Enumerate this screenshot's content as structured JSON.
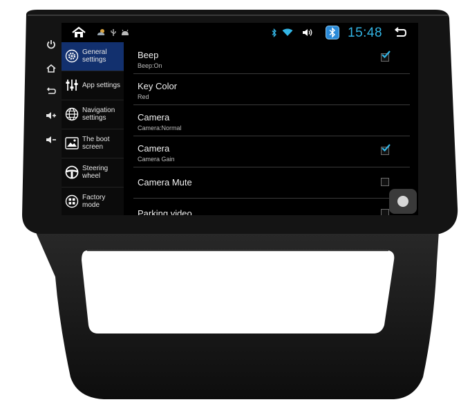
{
  "status_bar": {
    "clock": "15:48",
    "icons": [
      "home-icon",
      "weather-icon",
      "usb-icon",
      "android-icon",
      "bluetooth-icon",
      "wifi-icon",
      "volume-icon",
      "bluetooth-app-icon",
      "back-icon"
    ],
    "accent_color": "#33b5e5"
  },
  "bezel_buttons": [
    "power-icon",
    "home-icon",
    "back-icon",
    "volume-up-icon",
    "volume-down-icon"
  ],
  "side_menu": {
    "active_color": "#12306e",
    "items": [
      {
        "label": "General settings",
        "icon": "gear-icon",
        "active": true
      },
      {
        "label": "App settings",
        "icon": "sliders-icon",
        "active": false
      },
      {
        "label": "Navigation settings",
        "icon": "globe-icon",
        "active": false
      },
      {
        "label": "The boot screen",
        "icon": "image-icon",
        "active": false
      },
      {
        "label": "Steering wheel",
        "icon": "steering-wheel-icon",
        "active": false
      },
      {
        "label": "Factory mode",
        "icon": "grid-icon",
        "active": false
      }
    ]
  },
  "settings": [
    {
      "title": "Beep",
      "subtitle": "Beep:On",
      "checked": true
    },
    {
      "title": "Key Color",
      "subtitle": "Red",
      "checked": null
    },
    {
      "title": "Camera",
      "subtitle": "Camera:Normal",
      "checked": null
    },
    {
      "title": "Camera",
      "subtitle": "Camera Gain",
      "checked": true
    },
    {
      "title": "Camera Mute",
      "subtitle": "",
      "checked": false
    },
    {
      "title": "Parking video",
      "subtitle": "",
      "checked": false
    }
  ]
}
